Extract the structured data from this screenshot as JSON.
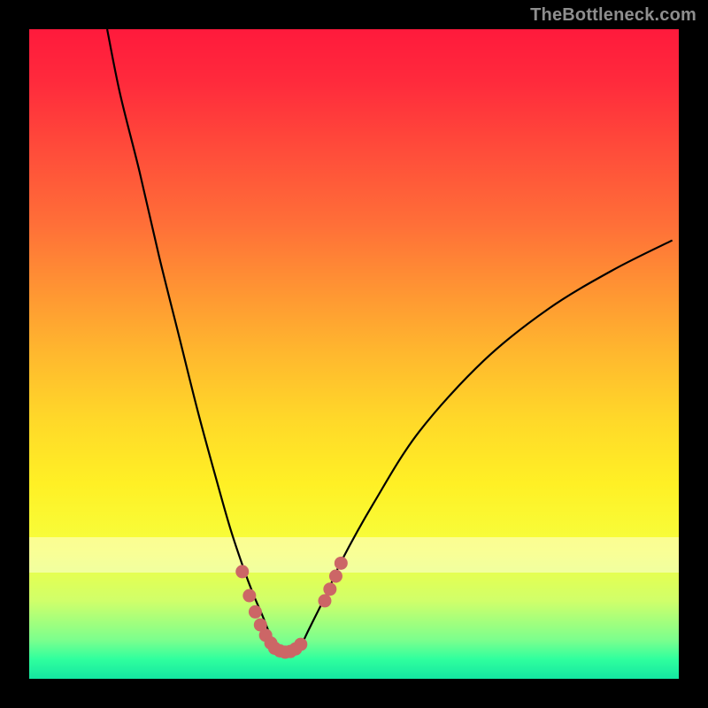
{
  "watermark": "TheBottleneck.com",
  "chart_data": {
    "type": "line",
    "title": "",
    "xlabel": "",
    "ylabel": "",
    "xlim": [
      0,
      100
    ],
    "ylim": [
      0,
      100
    ],
    "grid": false,
    "legend": false,
    "series": [
      {
        "name": "bottleneck-curve",
        "x": [
          12,
          14,
          17,
          20,
          23,
          26,
          29,
          31,
          33,
          34.5,
          36,
          37,
          38,
          39,
          40,
          41,
          42,
          43,
          44.5,
          46,
          48,
          53,
          60,
          70,
          80,
          90,
          99
        ],
        "y": [
          100,
          90,
          78,
          65,
          53,
          41,
          30,
          23,
          17,
          13,
          9.5,
          7,
          5.2,
          4.3,
          4.1,
          4.4,
          5.5,
          7.5,
          10.5,
          13.5,
          18,
          27,
          38,
          49,
          57,
          63,
          67.5
        ],
        "color": "#000000"
      },
      {
        "name": "optimal-marker-left",
        "x": [
          32.8,
          33.9,
          34.8,
          35.6,
          36.4,
          37.2
        ],
        "y": [
          16.5,
          12.8,
          10.3,
          8.3,
          6.7,
          5.5
        ],
        "color": "#cc6666"
      },
      {
        "name": "optimal-marker-bottom",
        "x": [
          37.8,
          38.6,
          39.4,
          40.2,
          41.0,
          41.8
        ],
        "y": [
          4.7,
          4.3,
          4.1,
          4.2,
          4.6,
          5.3
        ],
        "color": "#cc6666"
      },
      {
        "name": "optimal-marker-right",
        "x": [
          45.5,
          46.3,
          47.2,
          48.0
        ],
        "y": [
          12.0,
          13.8,
          15.8,
          17.8
        ],
        "color": "#cc6666"
      }
    ],
    "background_gradient": {
      "top": "#ff1a3c",
      "mid": "#fff025",
      "bottom": "#14e6a1"
    },
    "pale_band_y_range": [
      17,
      22
    ]
  }
}
